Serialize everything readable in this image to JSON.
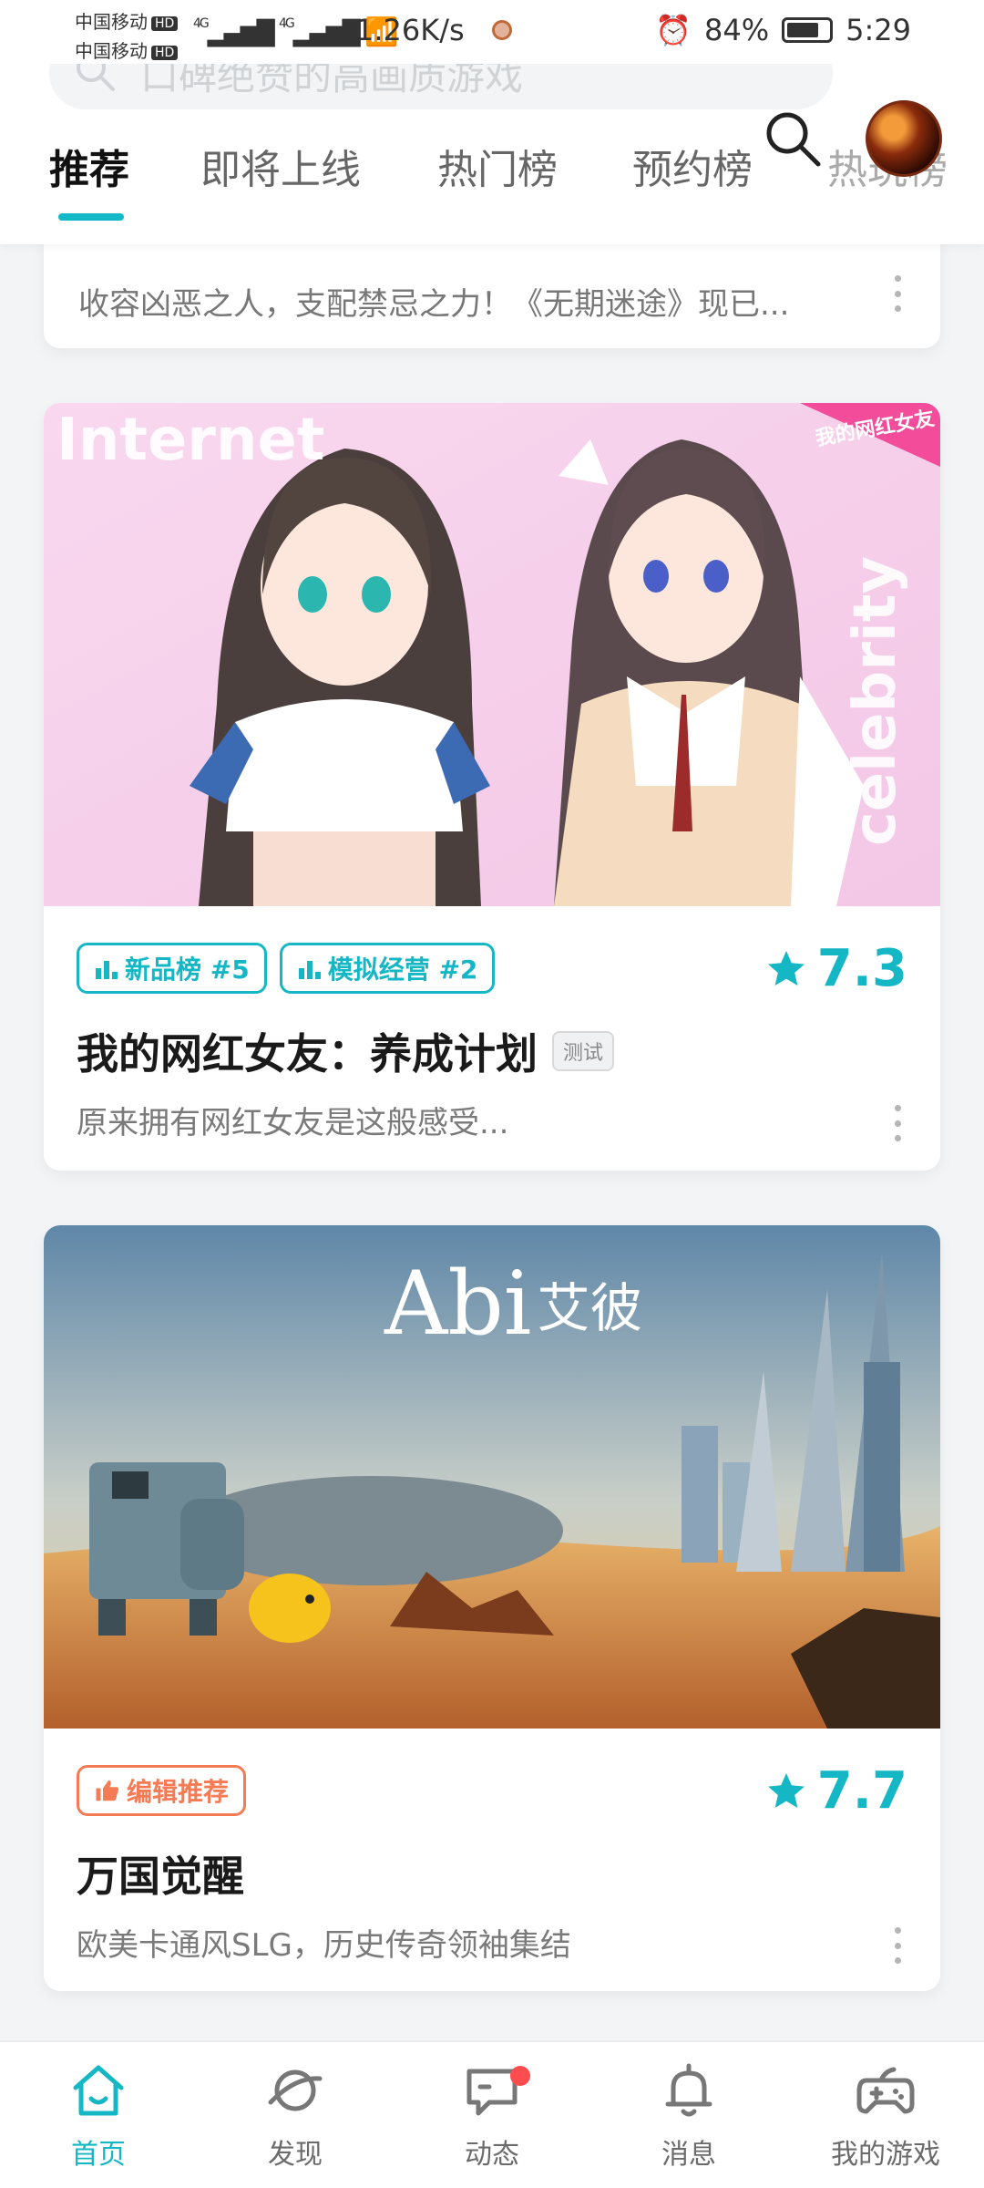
{
  "status_bar": {
    "carrier_1": "中国移动",
    "carrier_2": "中国移动",
    "hd": "HD",
    "signal": "4G",
    "net_speed": "1.26K/s",
    "battery_percent": "84%",
    "time": "5:29"
  },
  "search": {
    "placeholder": "口碑绝赞的高画质游戏"
  },
  "tabs": [
    {
      "label": "推荐",
      "active": true
    },
    {
      "label": "即将上线",
      "active": false
    },
    {
      "label": "热门榜",
      "active": false
    },
    {
      "label": "预约榜",
      "active": false
    },
    {
      "label": "热玩榜",
      "active": false
    }
  ],
  "feed": [
    {
      "desc": "收容凶恶之人，支配禁忌之力！《无期迷途》现已..."
    },
    {
      "cover_text_left": "Internet",
      "cover_text_right": "celebrity",
      "cover_logo": "我的网红女友",
      "tags": [
        {
          "label": "新品榜 #5",
          "icon": "ranking-icon"
        },
        {
          "label": "模拟经营 #2",
          "icon": "ranking-icon"
        }
      ],
      "rating": "7.3",
      "title": "我的网红女友：养成计划",
      "badge": "测试",
      "desc": "原来拥有网红女友是这般感受..."
    },
    {
      "cover_title": "Abi",
      "cover_title_cn": "艾彼",
      "tags": [
        {
          "label": "编辑推荐",
          "icon": "thumbs-up-icon"
        }
      ],
      "rating": "7.7",
      "title": "万国觉醒",
      "desc": "欧美卡通风SLG，历史传奇领袖集结"
    }
  ],
  "bottom_nav": [
    {
      "label": "首页",
      "icon": "home-icon",
      "active": true
    },
    {
      "label": "发现",
      "icon": "discover-icon",
      "active": false
    },
    {
      "label": "动态",
      "icon": "activity-icon",
      "active": false,
      "notification_dot": true
    },
    {
      "label": "消息",
      "icon": "bell-icon",
      "active": false
    },
    {
      "label": "我的游戏",
      "icon": "gamepad-icon",
      "active": false
    }
  ],
  "colors": {
    "accent": "#16b7c4",
    "editor_tag": "#f47b54",
    "notification": "#ff4d4f"
  }
}
